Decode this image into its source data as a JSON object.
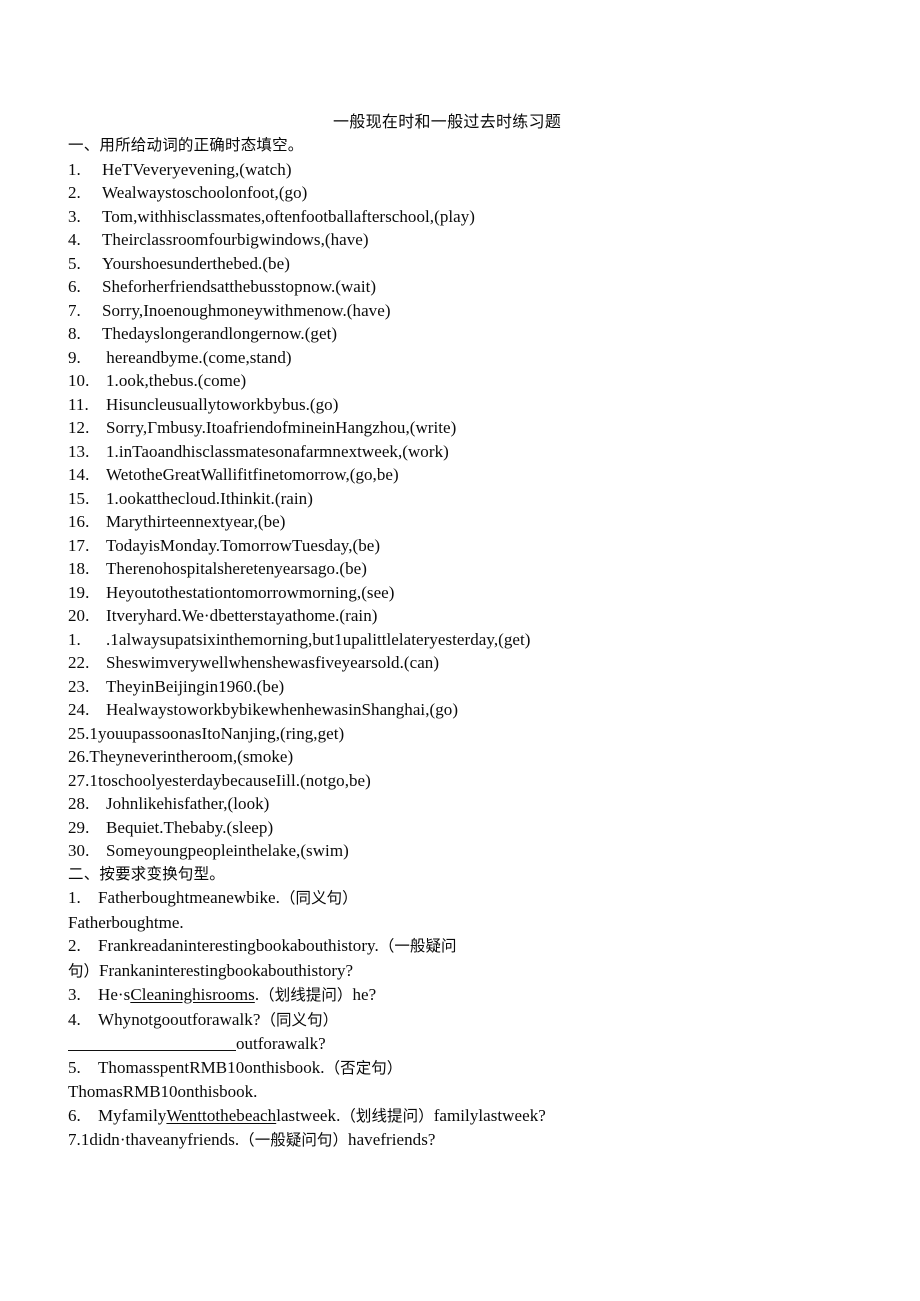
{
  "document": {
    "title": "一般现在时和一般过去时练习题",
    "sections": [
      {
        "heading": "一、用所给动词的正确时态填空。",
        "items": [
          {
            "num": "1.",
            "text": "HeTVeveryevening,(watch)"
          },
          {
            "num": "2.",
            "text": "Wealwaystoschoolonfoot,(go)"
          },
          {
            "num": "3.",
            "text": "Tom,withhisclassmates,oftenfootballafterschool,(play)"
          },
          {
            "num": "4.",
            "text": "Theirclassroomfourbigwindows,(have)"
          },
          {
            "num": "5.",
            "text": "Yourshoesunderthebed.(be)"
          },
          {
            "num": "6.",
            "text": "Sheforherfriendsatthebusstopnow.(wait)"
          },
          {
            "num": "7.",
            "text": "Sorry,Inoenoughmoneywithmenow.(have)"
          },
          {
            "num": "8.",
            "text": "Thedayslongerandlongernow.(get)"
          },
          {
            "num": "9.",
            "text": " hereandbyme.(come,stand)"
          },
          {
            "num": "10.",
            "text": "1.ook,thebus.(come)"
          },
          {
            "num": "11.",
            "text": "Hisuncleusuallytoworkbybus.(go)"
          },
          {
            "num": "12.",
            "text": "Sorry,Γmbusy.ItoafriendofmineinHangzhou,(write)"
          },
          {
            "num": "13.",
            "text": "1.inTaoandhisclassmatesonafarmnextweek,(work)"
          },
          {
            "num": "14.",
            "text": "WetotheGreatWallifitfinetomorrow,(go,be)"
          },
          {
            "num": "15.",
            "text": "1.ookatthecloud.Ithinkit.(rain)"
          },
          {
            "num": "16.",
            "text": "Marythirteennextyear,(be)"
          },
          {
            "num": "17.",
            "text": "TodayisMonday.TomorrowTuesday,(be)"
          },
          {
            "num": "18.",
            "text": "Therenohospitalsheretenyearsago.(be)"
          },
          {
            "num": "19.",
            "text": "Heyoutothestationtomorrowmorning,(see)"
          },
          {
            "num": "20.",
            "text": "Itveryhard.We·dbetterstayathome.(rain)"
          },
          {
            "num": "1.",
            "text": ".1alwaysupatsixinthemorning,but1upalittlelateryesterday,(get)"
          },
          {
            "num": "22.",
            "text": "Sheswimverywellwhenshewasfiveyearsold.(can)"
          },
          {
            "num": "23.",
            "text": "TheyinBeijingin1960.(be)"
          },
          {
            "num": "24.",
            "text": "HealwaystoworkbybikewhenhewasinShanghai,(go)"
          },
          {
            "num": "25.",
            "text": "1youupassoonasItoNanjing,(ring,get)"
          },
          {
            "num": "26.",
            "text": "Theyneverintheroom,(smoke)"
          },
          {
            "num": "27.",
            "text": "1toschoolyesterdaybecauseIill.(notgo,be)"
          },
          {
            "num": "28.",
            "text": "Johnlikehisfather,(look)"
          },
          {
            "num": "29.",
            "text": "Bequiet.Thebaby.(sleep)"
          },
          {
            "num": "30.",
            "text": "Someyoungpeopleinthelake,(swim)"
          }
        ]
      },
      {
        "heading": "二、按要求变换句型。",
        "items": [
          {
            "num": "1.",
            "text": "Fatherboughtmeanewbike.",
            "tag": "（同义句）",
            "answer": "Fatherboughtme."
          },
          {
            "num": "2.",
            "text": "Frankreadaninterestingbookabouthistory.",
            "tag": "（一般疑问",
            "tag_wrap": "句）",
            "answer": "Frankaninterestingbookabouthistory?"
          },
          {
            "num": "3.",
            "text_pre": "He·s",
            "text_underlined": "Cleaninghisrooms",
            "text_post": ".",
            "tag": "（划线提问）",
            "trailing": "he?"
          },
          {
            "num": "4.",
            "text": "Whynotgooutforawalk?",
            "tag": "（同义句）",
            "answer_blank": "____________________",
            "answer_tail": "outforawalk?"
          },
          {
            "num": "5.",
            "text": "ThomasspentRMB10onthisbook.",
            "tag": "（否定句）",
            "answer": "ThomasRMB10onthisbook."
          },
          {
            "num": "6.",
            "text_pre": "Myfamily",
            "text_underlined": "Wenttothebeach",
            "text_post": "lastweek.",
            "tag": "（划线提问）",
            "trailing": "familylastweek?"
          },
          {
            "num": "7.",
            "text": "1didn·thaveanyfriends.",
            "tag": "（一般疑问句）",
            "trailing": "havefriends?"
          }
        ]
      }
    ]
  }
}
